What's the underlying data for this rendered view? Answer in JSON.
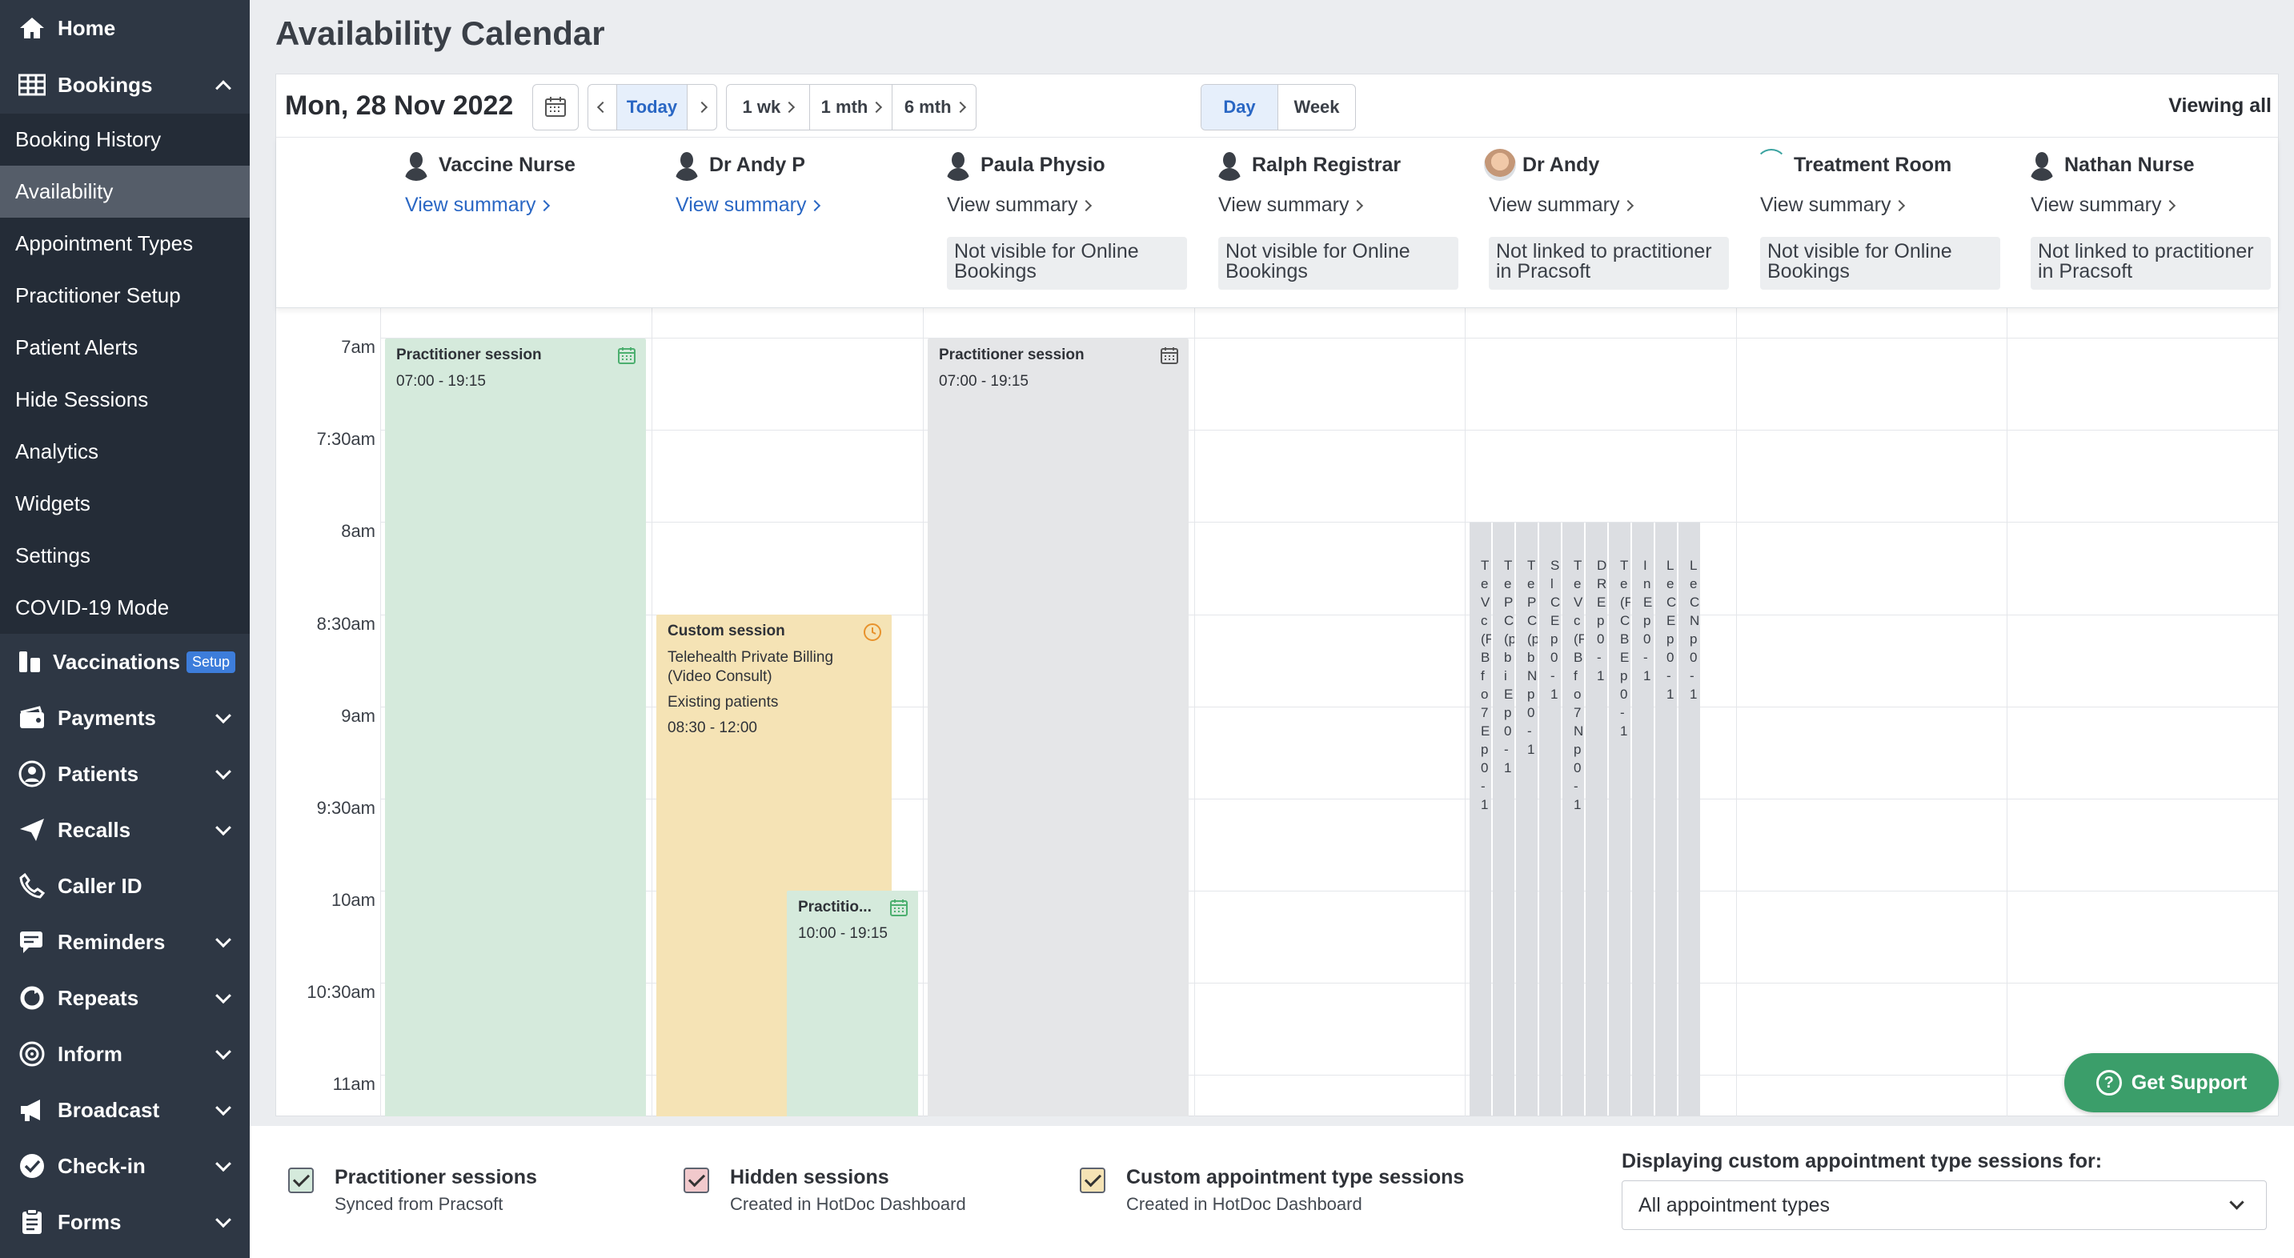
{
  "sidebar": {
    "home": "Home",
    "bookings": "Bookings",
    "sub_items": [
      "Booking History",
      "Availability",
      "Appointment Types",
      "Practitioner Setup",
      "Patient Alerts",
      "Hide Sessions",
      "Analytics",
      "Widgets",
      "Settings",
      "COVID-19 Mode"
    ],
    "vaccinations": "Vaccinations",
    "vaccinations_badge": "Setup",
    "groups": [
      "Payments",
      "Patients",
      "Recalls",
      "Caller ID",
      "Reminders",
      "Repeats",
      "Inform",
      "Broadcast",
      "Check-in",
      "Forms"
    ]
  },
  "page_title": "Availability Calendar",
  "toolbar": {
    "date": "Mon, 28 Nov 2022",
    "today": "Today",
    "one_week": "1 wk",
    "one_month": "1 mth",
    "six_month": "6 mth",
    "day": "Day",
    "week": "Week",
    "viewing": "Viewing all"
  },
  "practitioners": [
    {
      "name": "Vaccine Nurse",
      "summary": "View summary",
      "notice": ""
    },
    {
      "name": "Dr Andy P",
      "summary": "View summary",
      "notice": ""
    },
    {
      "name": "Paula Physio",
      "summary": "View summary",
      "notice": "Not visible for Online Bookings"
    },
    {
      "name": "Ralph Registrar",
      "summary": "View summary",
      "notice": "Not visible for Online Bookings"
    },
    {
      "name": "Dr Andy",
      "summary": "View summary",
      "notice": "Not linked to practitioner in Pracsoft"
    },
    {
      "name": "Treatment Room",
      "summary": "View summary",
      "notice": "Not visible for Online Bookings"
    },
    {
      "name": "Nathan Nurse",
      "summary": "View summary",
      "notice": "Not linked to practitioner in Pracsoft"
    }
  ],
  "time_labels": [
    "7am",
    "7:30am",
    "8am",
    "8:30am",
    "9am",
    "9:30am",
    "10am",
    "10:30am",
    "11am"
  ],
  "sessions": {
    "vaccine_nurse": {
      "title": "Practitioner session",
      "time": "07:00 - 19:15"
    },
    "dr_andy_p_custom": {
      "title": "Custom session",
      "line1": "Telehealth Private Billing (Video Consult)",
      "line2": "Existing patients",
      "time": "08:30 - 12:00"
    },
    "dr_andy_p_prac": {
      "title": "Practitio...",
      "time": "10:00 - 19:15"
    },
    "paula": {
      "title": "Practitioner session",
      "time": "07:00 - 19:15"
    }
  },
  "strips": [
    "TeVc(FBfo7Ep0-1",
    "TePC(pbiEp0-1",
    "TePC(pbNp0-1",
    "SlCEp0-1",
    "TeVc(FBfo7Np0-1",
    "DREp0-1",
    "Te(FCBEp0-1",
    "InEp0-1",
    "LeCEp0-1",
    "LeCNp0-1"
  ],
  "colors": {
    "practitioner": "#d5eadc",
    "custom": "#f5e3b5",
    "hidden": "#e5e6e8",
    "accent": "#2a67c4",
    "support": "#3b9e6a"
  },
  "support_button": "Get Support",
  "legend": {
    "items": [
      {
        "title": "Practitioner sessions",
        "subtitle": "Synced from Pracsoft"
      },
      {
        "title": "Hidden sessions",
        "subtitle": "Created in HotDoc Dashboard"
      },
      {
        "title": "Custom appointment type sessions",
        "subtitle": "Created in HotDoc Dashboard"
      }
    ],
    "display_label": "Displaying custom appointment type sessions for:",
    "selected": "All appointment types"
  }
}
